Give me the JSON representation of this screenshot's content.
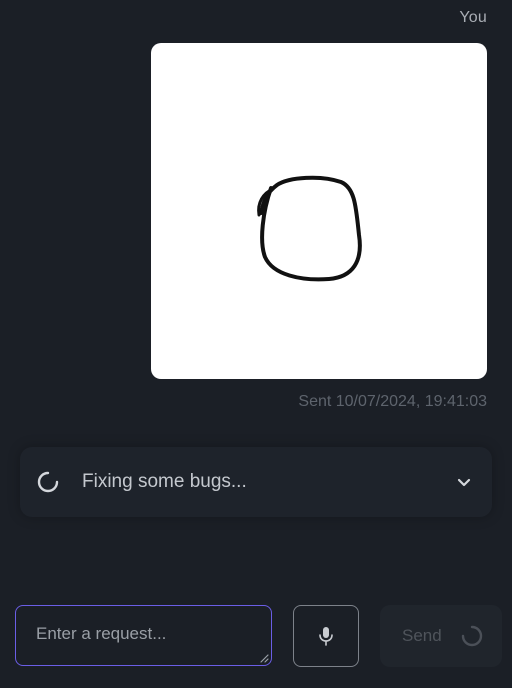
{
  "message": {
    "sender": "You",
    "attachment_icon": "hand-drawn-circle-image",
    "sent_label": "Sent 10/07/2024, 19:41:03"
  },
  "status": {
    "text": "Fixing some bugs...",
    "icon": "spinner-icon",
    "toggle_icon": "chevron-down-icon"
  },
  "composer": {
    "placeholder": "Enter a request...",
    "value": "",
    "mic_icon": "microphone-icon",
    "send_label": "Send",
    "send_icon": "spinner-icon",
    "accent_color": "#6b5ee6"
  }
}
